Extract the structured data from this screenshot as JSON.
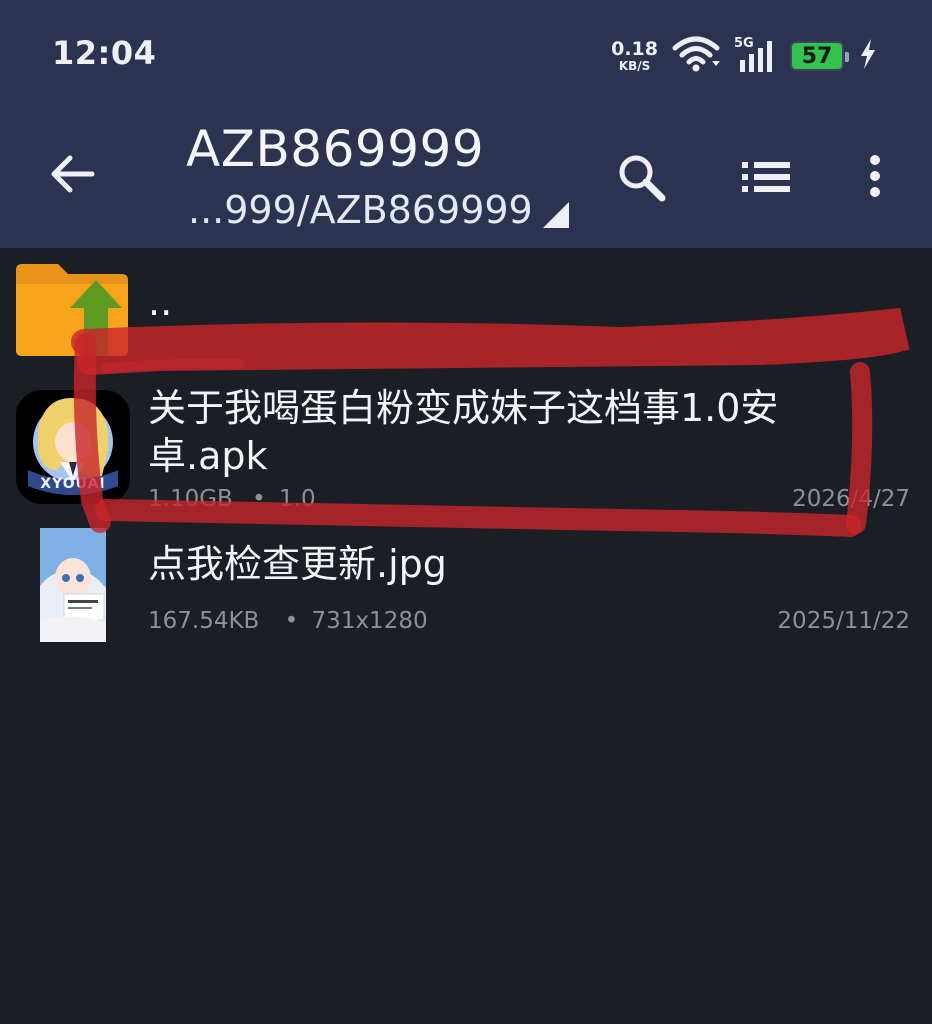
{
  "status_bar": {
    "time": "12:04",
    "net_speed_value": "0.18",
    "net_speed_unit": "KB/S",
    "network_type": "5G",
    "battery_level": "57",
    "icons": [
      "wifi-icon",
      "cellular-signal-icon",
      "battery-icon",
      "charging-bolt-icon"
    ]
  },
  "header": {
    "title": "AZB869999",
    "path": "...999/AZB869999",
    "icons": [
      "back-arrow-icon",
      "path-dropdown-triangle-icon",
      "search-icon",
      "list-view-icon",
      "more-vert-icon"
    ]
  },
  "files": [
    {
      "name": "..",
      "icon": "parent-folder-up-icon"
    },
    {
      "name": "关于我喝蛋白粉变成妹子这档事1.0安卓.apk",
      "size": "1.10GB",
      "detail": "1.0",
      "date": "2026/4/27",
      "icon": "apk-app-icon",
      "badge_text": "XYOUAI"
    },
    {
      "name": "点我检查更新.jpg",
      "size": "167.54KB",
      "detail": "731x1280",
      "date": "2025/11/22",
      "icon": "image-thumbnail"
    }
  ],
  "colors": {
    "header_bg": "#2b3350",
    "list_bg": "#1b1e24",
    "annotation_red": "#c8262b",
    "battery_green": "#33c24d",
    "folder_orange": "#f7a41c",
    "folder_arrow_green": "#5f9a22"
  }
}
